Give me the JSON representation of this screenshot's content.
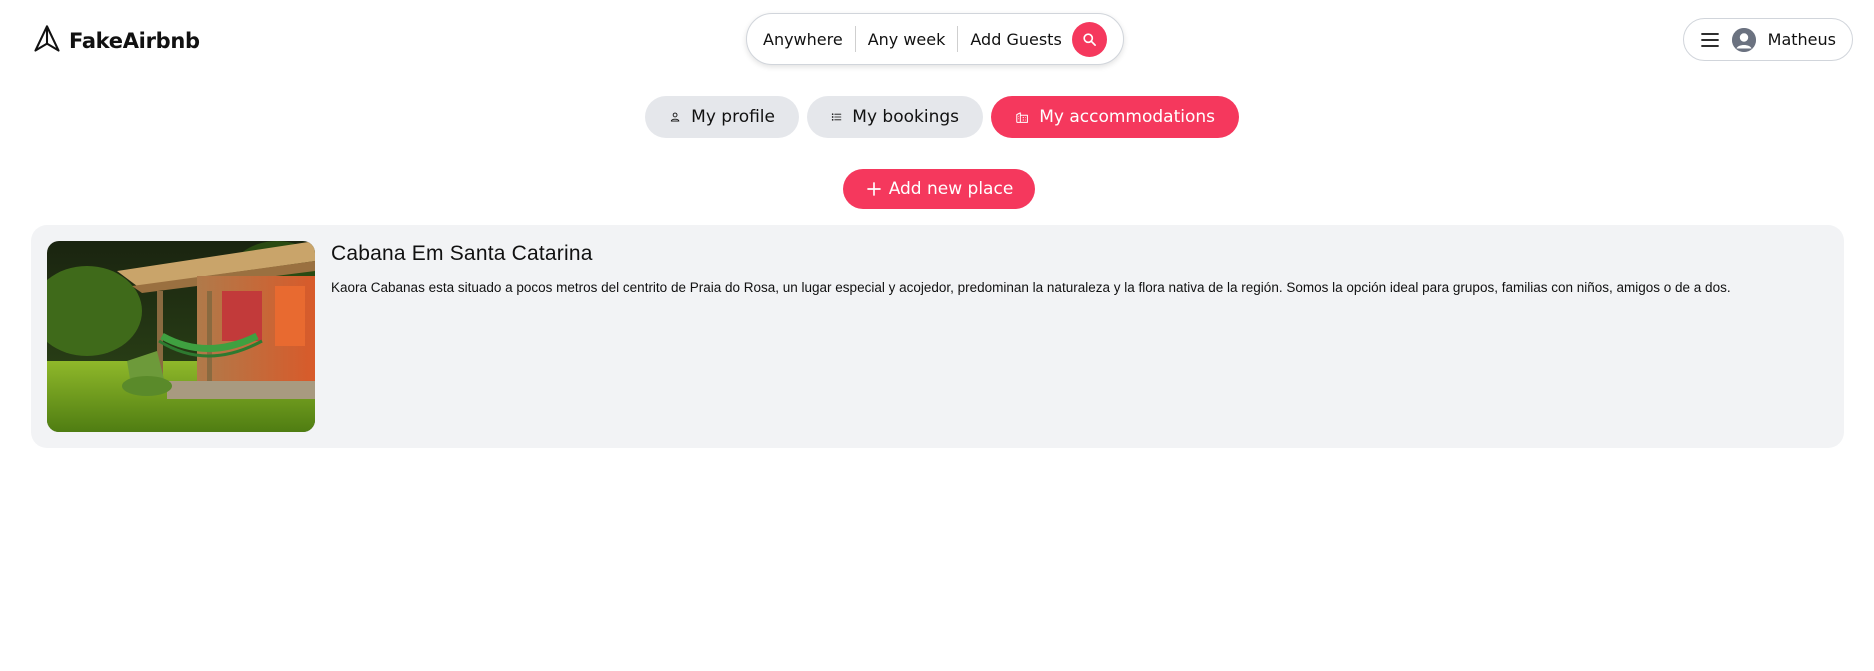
{
  "header": {
    "logo_text": "FakeAirbnb",
    "search": {
      "location": "Anywhere",
      "week": "Any week",
      "guests": "Add Guests"
    },
    "user": {
      "name": "Matheus"
    }
  },
  "tabs": [
    {
      "label": "My profile",
      "icon": "user-icon",
      "active": false
    },
    {
      "label": "My bookings",
      "icon": "list-icon",
      "active": false
    },
    {
      "label": "My accommodations",
      "icon": "building-icon",
      "active": true
    }
  ],
  "add_button": {
    "label": "Add new place",
    "icon": "plus-icon"
  },
  "places": [
    {
      "title": "Cabana Em Santa Catarina",
      "description": "Kaora Cabanas esta situado a pocos metros del centrito de Praia do Rosa, un lugar especial y acojedor, predominan la naturaleza y la flora nativa de la región. Somos la opción ideal para grupos, familias con niños, amigos o de a dos."
    }
  ],
  "colors": {
    "accent": "#f5385d",
    "tab_bg": "#e5e7eb",
    "card_bg": "#f2f3f5"
  }
}
